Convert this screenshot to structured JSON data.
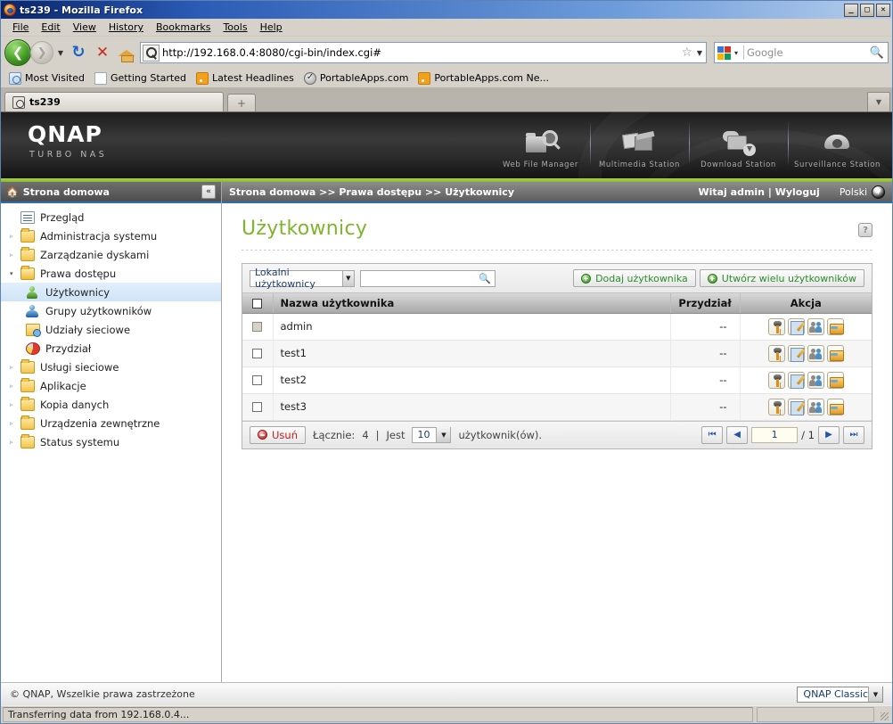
{
  "window": {
    "title": "ts239 - Mozilla Firefox",
    "buttons": {
      "minimize": "_",
      "maximize": "□",
      "close": "✕"
    }
  },
  "menu": [
    "File",
    "Edit",
    "View",
    "History",
    "Bookmarks",
    "Tools",
    "Help"
  ],
  "toolbar": {
    "back": "❮",
    "forward": "❯",
    "dropdown": "▼",
    "reload": "↻",
    "stop": "✕",
    "home": "home-icon",
    "url": "http://192.168.0.4:8080/cgi-bin/index.cgi#",
    "star": "☆",
    "url_dropdown": "▼",
    "search_placeholder": "Google",
    "search_value": "",
    "search_icon": "🔍"
  },
  "bookmarks": [
    {
      "label": "Most Visited",
      "icon": "globe-icon"
    },
    {
      "label": "Getting Started",
      "icon": "page-icon"
    },
    {
      "label": "Latest Headlines",
      "icon": "feed-icon"
    },
    {
      "label": "PortableApps.com",
      "icon": "check-icon"
    },
    {
      "label": "PortableApps.com Ne...",
      "icon": "feed-icon"
    }
  ],
  "tabs": {
    "items": [
      {
        "label": "ts239"
      }
    ],
    "new_tab": "+",
    "tab_list": "▼"
  },
  "banner": {
    "logo": "QNAP",
    "tagline": "TURBO NAS",
    "stations": [
      {
        "label": "Web File Manager",
        "icon": "web-file-manager-icon"
      },
      {
        "label": "Multimedia Station",
        "icon": "multimedia-station-icon"
      },
      {
        "label": "Download Station",
        "icon": "download-station-icon"
      },
      {
        "label": "Surveillance Station",
        "icon": "surveillance-station-icon"
      }
    ]
  },
  "sidebar": {
    "header": "Strona domowa",
    "collapse": "«",
    "items": [
      {
        "label": "Przegląd",
        "icon": "overview-icon",
        "arrow": "",
        "level": 1,
        "selected": false
      },
      {
        "label": "Administracja systemu",
        "icon": "folder-icon",
        "arrow": "▹",
        "level": 1,
        "selected": false
      },
      {
        "label": "Zarządzanie dyskami",
        "icon": "folder-icon",
        "arrow": "▹",
        "level": 1,
        "selected": false
      },
      {
        "label": "Prawa dostępu",
        "icon": "folder-open-icon",
        "arrow": "▾",
        "level": 1,
        "selected": false
      },
      {
        "label": "Użytkownicy",
        "icon": "user-icon",
        "arrow": "",
        "level": 2,
        "selected": true
      },
      {
        "label": "Grupy użytkowników",
        "icon": "user-group-icon",
        "arrow": "",
        "level": 2,
        "selected": false
      },
      {
        "label": "Udziały sieciowe",
        "icon": "share-folder-icon",
        "arrow": "",
        "level": 2,
        "selected": false
      },
      {
        "label": "Przydział",
        "icon": "quota-icon",
        "arrow": "",
        "level": 2,
        "selected": false
      },
      {
        "label": "Usługi sieciowe",
        "icon": "folder-icon",
        "arrow": "▹",
        "level": 1,
        "selected": false
      },
      {
        "label": "Aplikacje",
        "icon": "folder-icon",
        "arrow": "▹",
        "level": 1,
        "selected": false
      },
      {
        "label": "Kopia danych",
        "icon": "folder-icon",
        "arrow": "▹",
        "level": 1,
        "selected": false
      },
      {
        "label": "Urządzenia zewnętrzne",
        "icon": "folder-icon",
        "arrow": "▹",
        "level": 1,
        "selected": false
      },
      {
        "label": "Status systemu",
        "icon": "folder-icon",
        "arrow": "▹",
        "level": 1,
        "selected": false
      }
    ]
  },
  "topbar": {
    "breadcrumb": "Strona domowa >> Prawa dostępu >> Użytkownicy",
    "welcome": "Witaj admin | Wyloguj",
    "language": "Polski"
  },
  "main": {
    "title": "Użytkownicy",
    "help": "?",
    "toolbar": {
      "filter_value": "Lokalni użytkownicy",
      "filter_arrow": "▼",
      "search_value": "",
      "search_icon": "🔍",
      "add_user": "Dodaj użytkownika",
      "create_many": "Utwórz wielu użytkowników"
    },
    "table": {
      "columns": [
        "",
        "Nazwa użytkownika",
        "Przydział",
        "Akcja"
      ],
      "action_icons": [
        "password-key-icon",
        "edit-icon",
        "user-group-icon",
        "shared-folder-icon"
      ],
      "rows": [
        {
          "name": "admin",
          "quota": "--",
          "checked": false,
          "disabled": true
        },
        {
          "name": "test1",
          "quota": "--",
          "checked": false,
          "disabled": false
        },
        {
          "name": "test2",
          "quota": "--",
          "checked": false,
          "disabled": false
        },
        {
          "name": "test3",
          "quota": "--",
          "checked": false,
          "disabled": false
        }
      ]
    },
    "footer": {
      "delete": "Usuń",
      "total_label": "Łącznie:",
      "total_value": "4",
      "divider": "|",
      "is_label": "Jest",
      "page_size": "10",
      "page_size_arrow": "▼",
      "unit_label": "użytkownik(ów).",
      "first": "⏮",
      "prev": "◀",
      "page_number": "1",
      "page_total": "/ 1",
      "next": "▶",
      "last": "⏭"
    }
  },
  "page_footer": {
    "copyright": "© QNAP, Wszelkie prawa zastrzeżone",
    "theme": "QNAP Classic",
    "theme_arrow": "▼"
  },
  "statusbar": {
    "message": "Transferring data from 192.168.0.4..."
  },
  "colors": {
    "accent_green": "#7fb52b",
    "brand_dark": "#2a2a2a",
    "link_blue": "#1a3c6e",
    "delete_red": "#c02020"
  }
}
